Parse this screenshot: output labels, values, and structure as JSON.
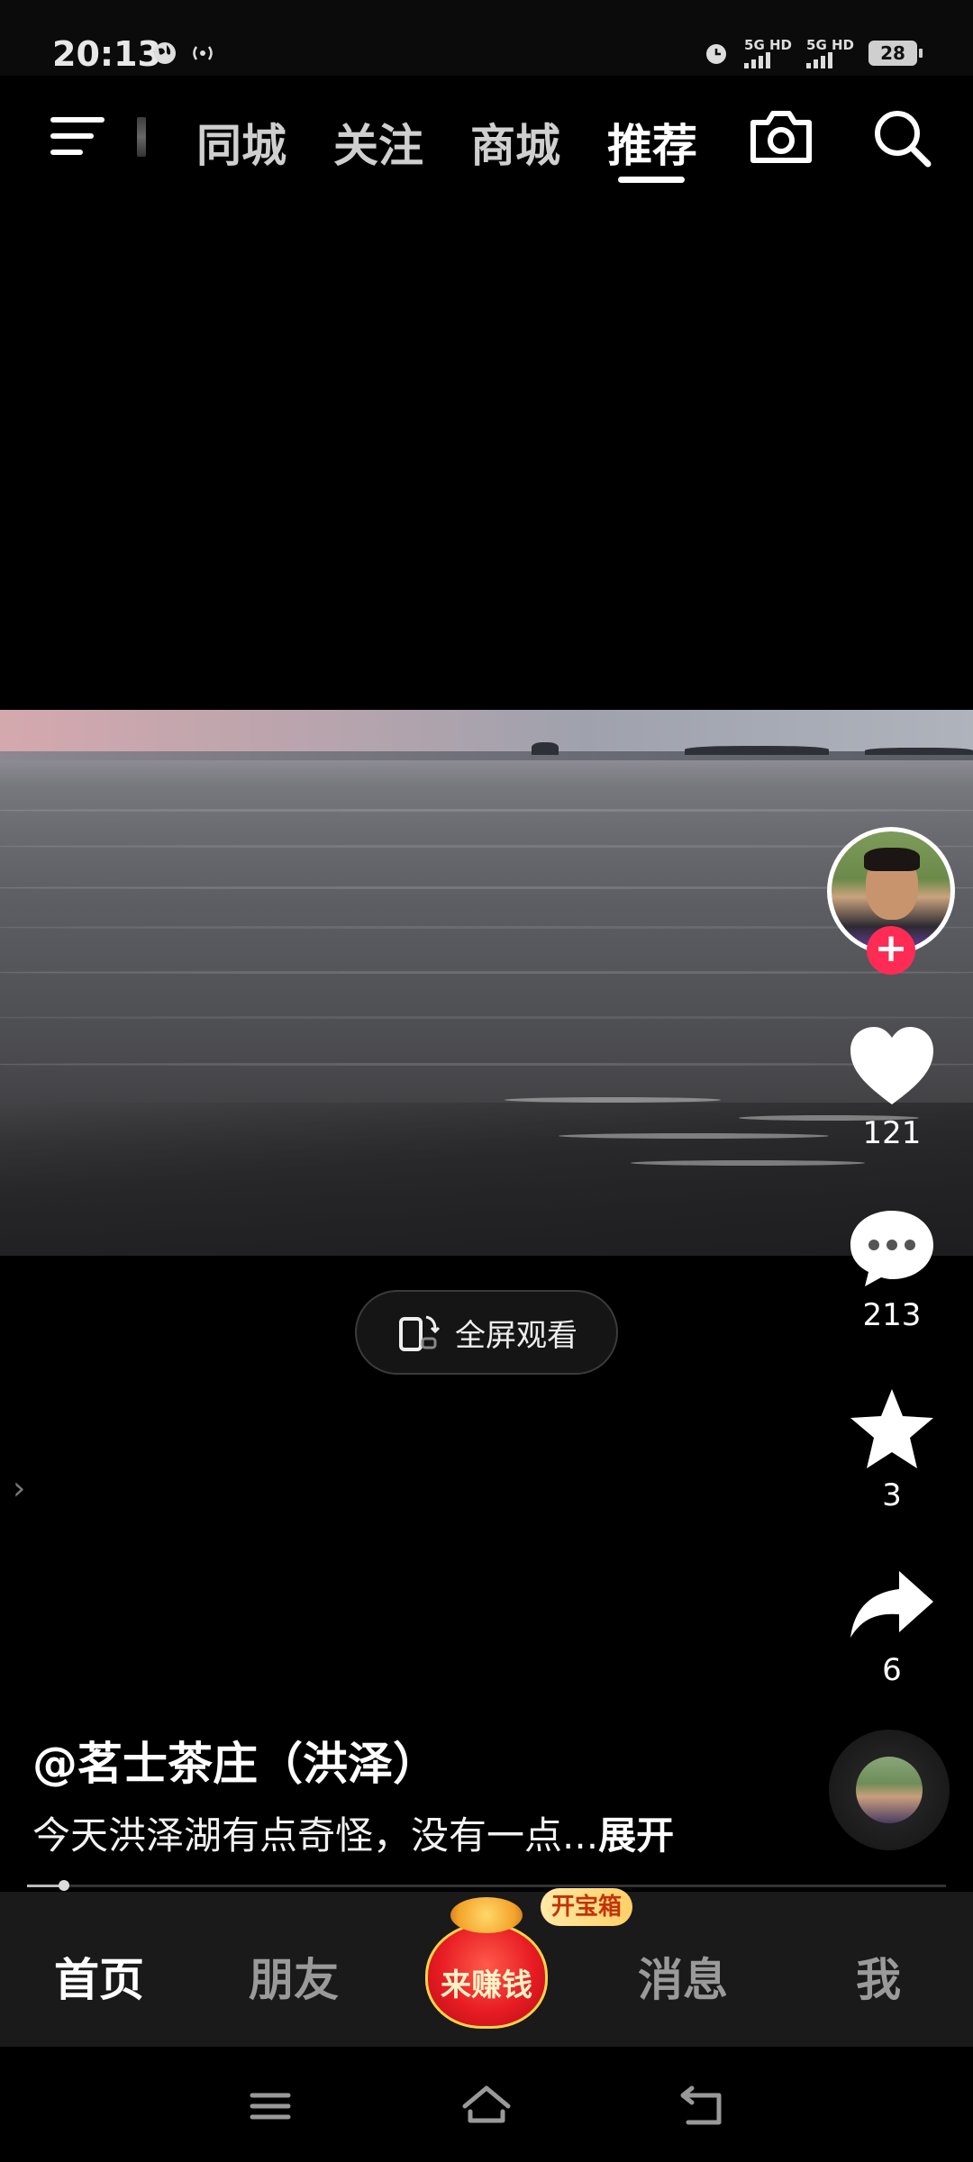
{
  "status_bar": {
    "time": "20:13",
    "signal1_label": "5G HD",
    "signal2_label": "5G HD",
    "battery": "28",
    "icons": [
      "globe-icon",
      "hotspot-icon",
      "alarm-icon"
    ]
  },
  "top_nav": {
    "tabs": [
      "同城",
      "关注",
      "商城",
      "推荐"
    ],
    "active_tab": "推荐",
    "icons": [
      "menu-icon",
      "camera-icon",
      "search-icon"
    ]
  },
  "fullscreen": {
    "label": "全屏观看"
  },
  "right_rail": {
    "likes": "121",
    "comments": "213",
    "favorites": "3",
    "shares": "6",
    "follow_icon": "plus-icon"
  },
  "post": {
    "author": "@茗士茶庄（洪泽）",
    "description": "今天洪泽湖有点奇怪，没有一点...",
    "expand_label": "展开",
    "progress": 0.04
  },
  "bottom_tabs": {
    "home": "首页",
    "friends": "朋友",
    "earn": "来赚钱",
    "treasure_badge": "开宝箱",
    "messages": "消息",
    "me": "我"
  },
  "colors": {
    "accent": "#fe2c55",
    "background": "#000000",
    "tabbar": "#1a1a1a"
  }
}
